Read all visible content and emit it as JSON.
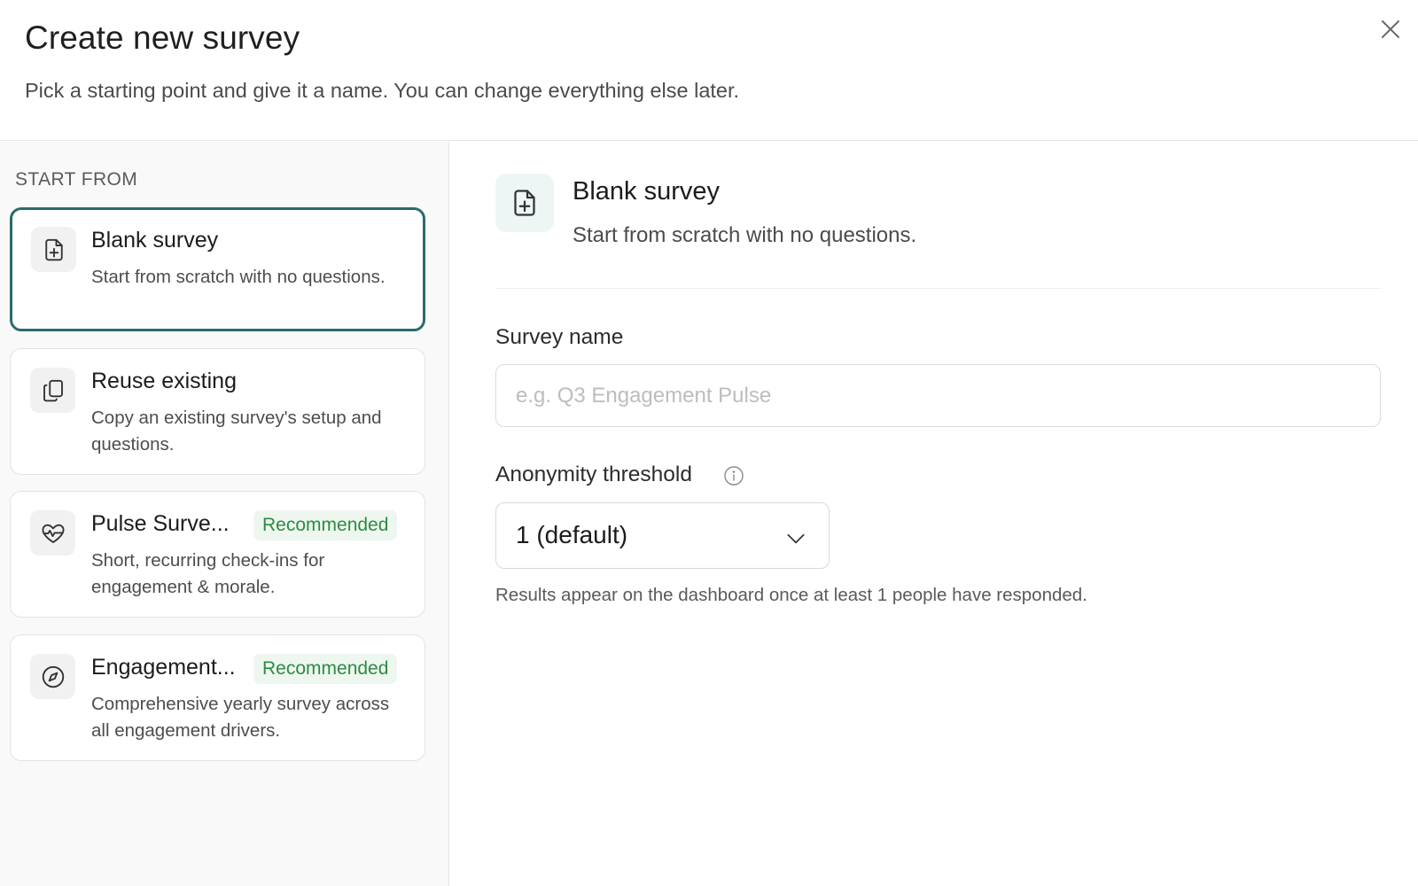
{
  "header": {
    "title": "Create new survey",
    "subtitle": "Pick a starting point and give it a name. You can change everything else later.",
    "close_icon": "close-icon"
  },
  "sidebar": {
    "section_label": "START FROM",
    "cards": [
      {
        "title": "Blank survey",
        "description": "Start from scratch with no questions.",
        "icon": "file-plus-icon",
        "selected": true
      },
      {
        "title": "Reuse existing",
        "description": "Copy an existing survey's setup and questions.",
        "icon": "copy-icon",
        "selected": false
      },
      {
        "title": "Pulse Surve...",
        "badge": "Recommended",
        "description": "Short, recurring check-ins for engagement & morale.",
        "icon": "heart-pulse-icon",
        "selected": false
      },
      {
        "title": "Engagement...",
        "badge": "Recommended",
        "description": "Comprehensive yearly survey across all engagement drivers.",
        "icon": "compass-icon",
        "selected": false
      }
    ]
  },
  "main": {
    "selected_title": "Blank survey",
    "selected_description": "Start from scratch with no questions.",
    "survey_name_label": "Survey name",
    "survey_name_placeholder": "e.g. Q3 Engagement Pulse",
    "survey_name_value": "",
    "anonymity_label": "Anonymity threshold",
    "anonymity_selected": "1 (default)",
    "anonymity_hint": "Results appear on the dashboard once at least 1 people have responded."
  },
  "colors": {
    "accent": "#2b6b68",
    "badge_text": "#2f8a43",
    "badge_bg": "#eef7ef"
  }
}
